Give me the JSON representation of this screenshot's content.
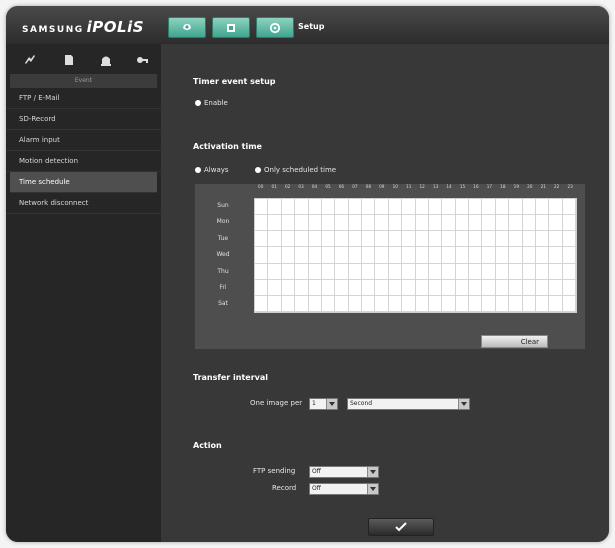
{
  "header": {
    "brand_primary": "SAMSUNG",
    "brand_secondary": "iPOLiS",
    "section_title": "Setup",
    "nav_tabs": [
      {
        "icon": "camera-icon"
      },
      {
        "icon": "playback-icon"
      },
      {
        "icon": "gear-icon"
      }
    ]
  },
  "sidebar": {
    "icons": [
      "video-icon",
      "document-icon",
      "alarm-icon",
      "key-icon"
    ],
    "category": "Event",
    "items": [
      {
        "label": "FTP / E-Mail"
      },
      {
        "label": "SD-Record"
      },
      {
        "label": "Alarm input"
      },
      {
        "label": "Motion detection"
      },
      {
        "label": "Time schedule",
        "selected": true
      },
      {
        "label": "Network disconnect"
      }
    ]
  },
  "main": {
    "timer_event": {
      "title": "Timer event setup",
      "enable_label": "Enable"
    },
    "activation": {
      "title": "Activation time",
      "option_always": "Always",
      "option_scheduled": "Only scheduled time",
      "hours": [
        "00",
        "01",
        "02",
        "03",
        "04",
        "05",
        "06",
        "07",
        "08",
        "09",
        "10",
        "11",
        "12",
        "13",
        "14",
        "15",
        "16",
        "17",
        "18",
        "19",
        "20",
        "21",
        "22",
        "23"
      ],
      "days": [
        "Sun",
        "Mon",
        "Tue",
        "Wed",
        "Thu",
        "Fri",
        "Sat"
      ],
      "clear_label": "Clear"
    },
    "transfer": {
      "title": "Transfer interval",
      "label": "One image per",
      "value": "1",
      "unit": "Second"
    },
    "action": {
      "title": "Action",
      "ftp_label": "FTP sending",
      "ftp_value": "Off",
      "record_label": "Record",
      "record_value": "Off"
    }
  },
  "colors": {
    "accent_tab": "#4fb39c",
    "background": "#383838",
    "sidebar": "#262626"
  }
}
